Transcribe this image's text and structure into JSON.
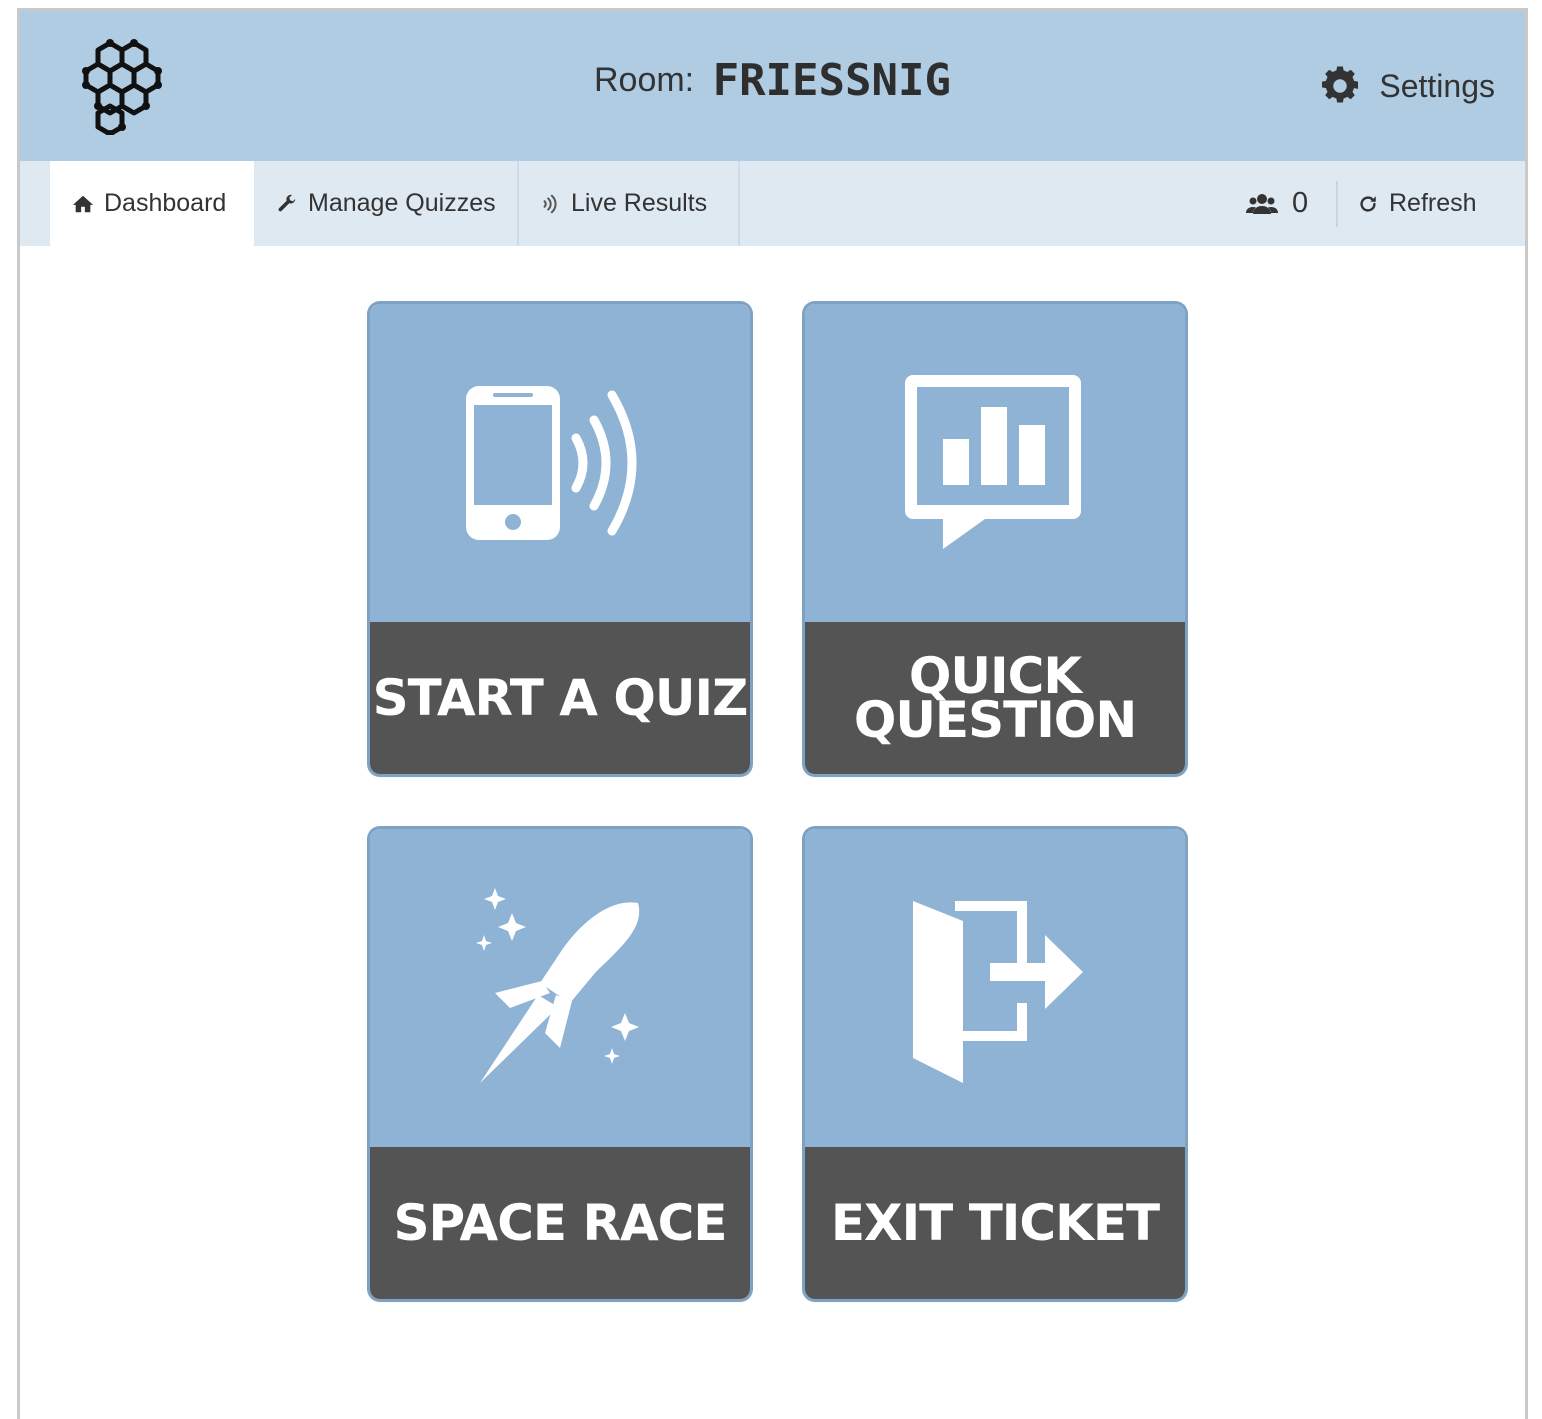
{
  "header": {
    "room_label": "Room:",
    "room_code": "FRIESSNIG",
    "settings_label": "Settings"
  },
  "nav": {
    "tabs": [
      {
        "label": "Dashboard",
        "icon": "home-icon",
        "active": true
      },
      {
        "label": "Manage Quizzes",
        "icon": "wrench-icon",
        "active": false
      },
      {
        "label": "Live Results",
        "icon": "broadcast-icon",
        "active": false
      }
    ],
    "student_count": "0",
    "refresh_label": "Refresh"
  },
  "tiles": [
    {
      "label": "START A QUIZ",
      "icon": "phone-signal-icon"
    },
    {
      "label": "QUICK QUESTION",
      "icon": "chart-bubble-icon"
    },
    {
      "label": "SPACE RACE",
      "icon": "rocket-icon"
    },
    {
      "label": "EXIT TICKET",
      "icon": "exit-door-icon"
    }
  ],
  "colors": {
    "header_bg": "#b0cce2",
    "nav_bg": "#dfe9f2",
    "tile_art_bg": "#8fb3d4",
    "tile_label_bg": "#545454"
  }
}
